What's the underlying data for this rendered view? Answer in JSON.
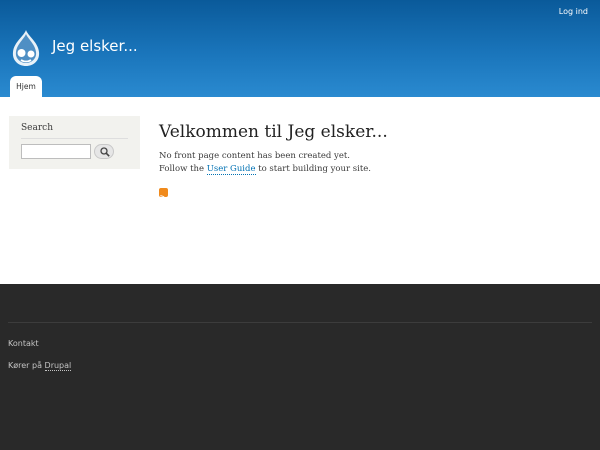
{
  "header": {
    "login_label": "Log ind",
    "site_name": "Jeg elsker...",
    "logo_icon": "drupal-drop-icon",
    "tabs": [
      {
        "label": "Hjem"
      }
    ]
  },
  "sidebar": {
    "search": {
      "title": "Search",
      "value": "",
      "button_icon": "magnifier-icon"
    }
  },
  "main": {
    "title": "Velkommen til Jeg elsker...",
    "line1": "No front page content has been created yet.",
    "line2_prefix": "Follow the ",
    "line2_link": "User Guide",
    "line2_suffix": " to start building your site.",
    "feed_icon": "rss-icon"
  },
  "footer": {
    "contact_label": "Kontakt",
    "powered_prefix": "Kører på ",
    "powered_link": "Drupal"
  },
  "colors": {
    "header_top": "#0a5a9a",
    "header_bottom": "#2a8ad0",
    "link": "#0071b3",
    "footer_bg": "#292929",
    "rss": "#f08a1c"
  }
}
